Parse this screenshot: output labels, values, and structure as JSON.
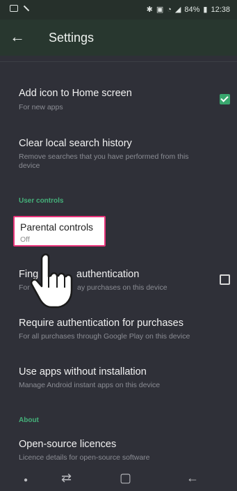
{
  "status_bar": {
    "battery": "84%",
    "time": "12:38"
  },
  "app_bar": {
    "title": "Settings",
    "back_icon": "arrow-left-icon"
  },
  "items": {
    "add_icon": {
      "title": "Add icon to Home screen",
      "subtitle": "For new apps",
      "checked": true
    },
    "clear_history": {
      "title": "Clear local search history",
      "subtitle_line1": "Remove searches that you have performed from this",
      "subtitle_line2": "device"
    },
    "user_controls_header": "User controls",
    "parental": {
      "title": "Parental controls",
      "subtitle": "Off"
    },
    "fingerprint": {
      "title_left": "Fing",
      "title_right": "authentication",
      "subtitle_left": "For",
      "subtitle_right": "ay purchases on this device",
      "checked": false
    },
    "require_auth": {
      "title": "Require authentication for purchases",
      "subtitle": "For all purchases through Google Play on this device"
    },
    "instant_apps": {
      "title": "Use apps without installation",
      "subtitle": "Manage Android instant apps on this device"
    },
    "about_header": "About",
    "licences": {
      "title": "Open-source licences",
      "subtitle": "Licence details for open-source software"
    }
  },
  "colors": {
    "accent": "#39a66e",
    "highlight_border": "#e8347a",
    "background": "#2f3038",
    "app_bar": "#28372f"
  },
  "nav_icons": [
    "dot-icon",
    "recent-apps-icon",
    "home-icon",
    "back-icon"
  ]
}
